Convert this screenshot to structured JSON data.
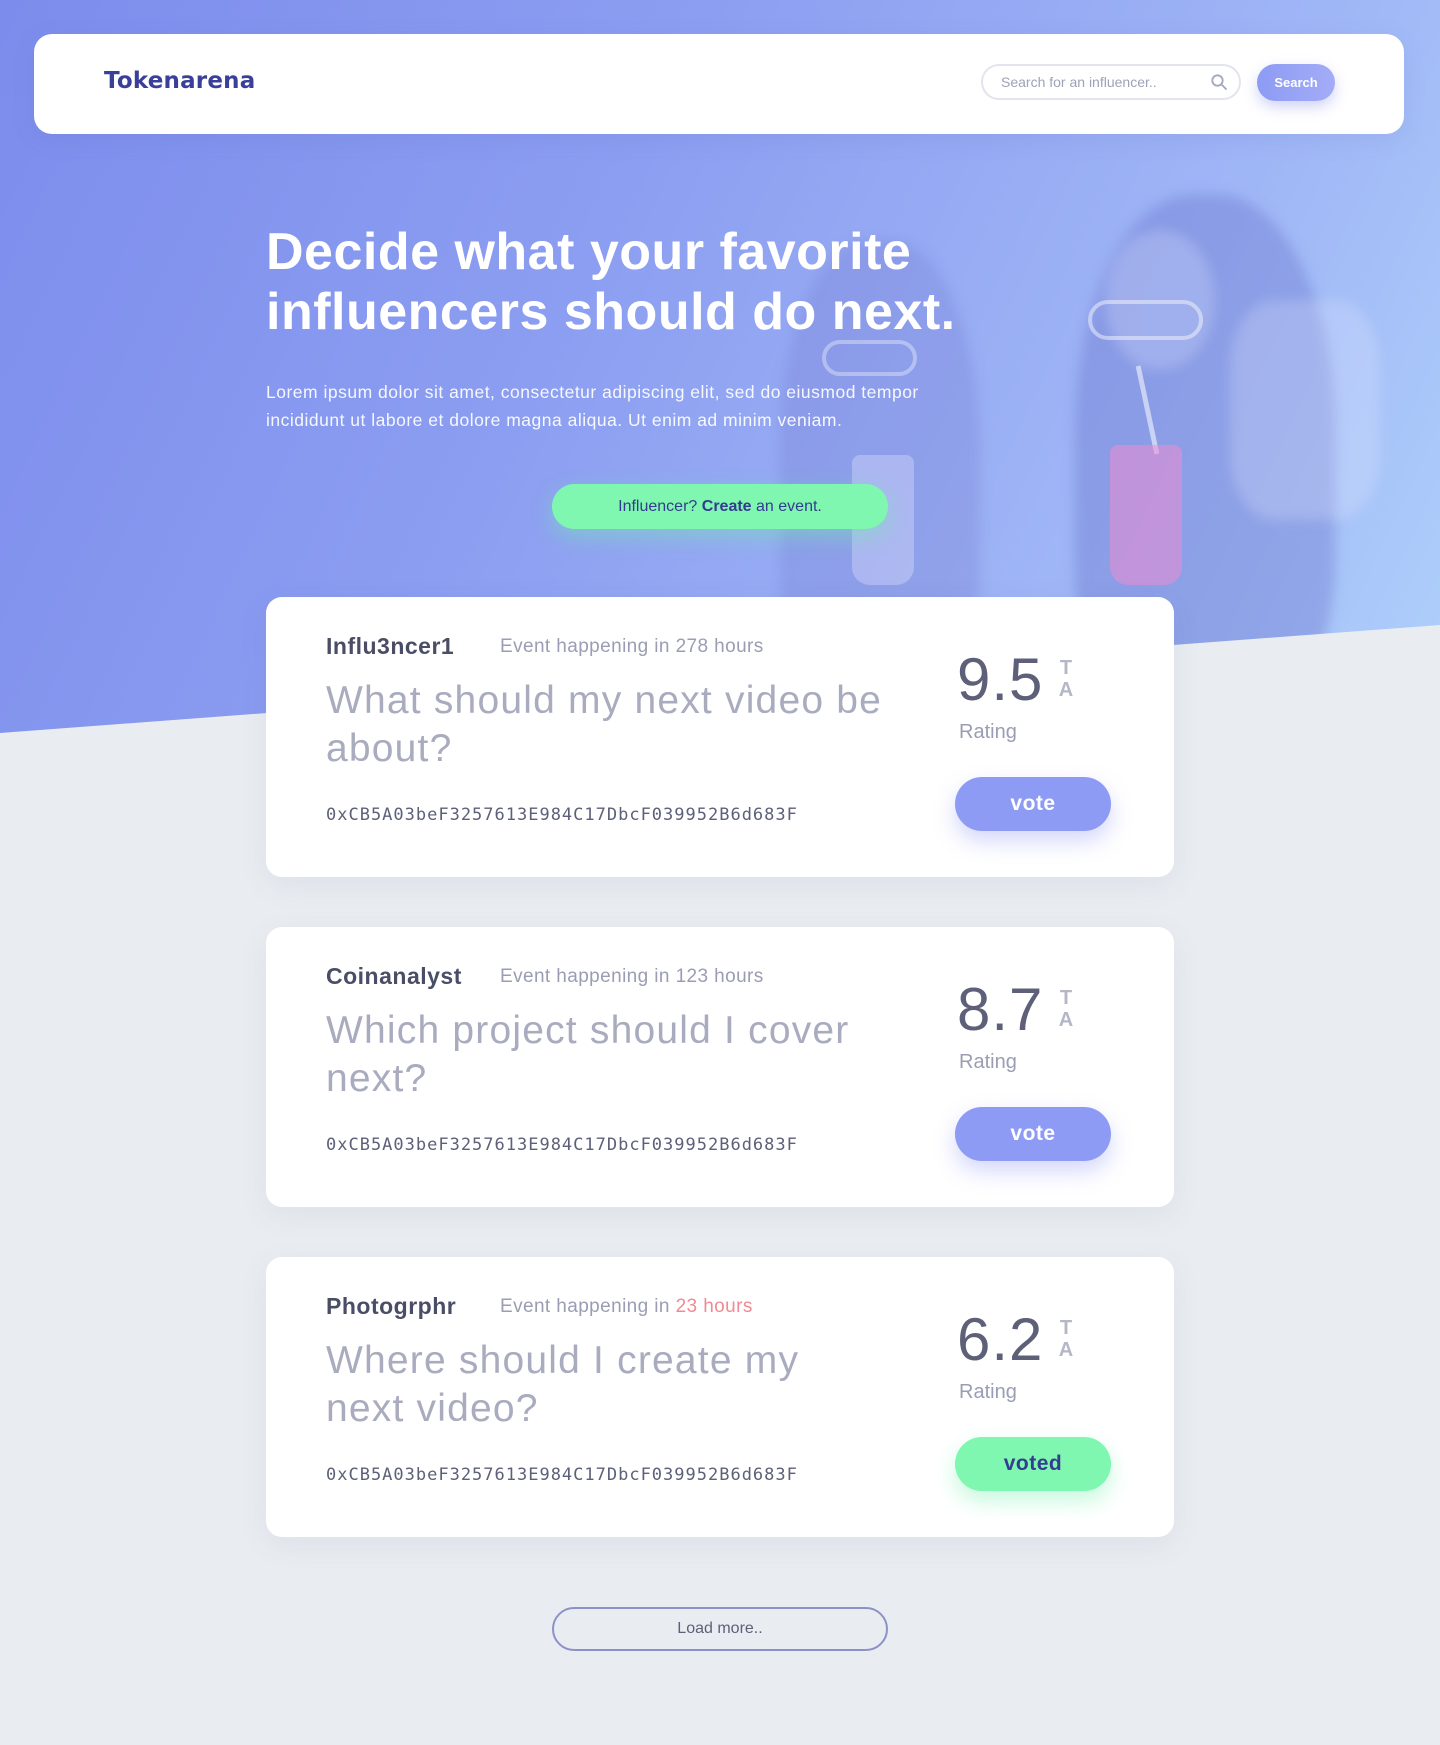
{
  "header": {
    "logo": "Tokenarena",
    "search_placeholder": "Search for an influencer..",
    "search_button": "Search",
    "search_icon": "magnifier-icon"
  },
  "hero": {
    "title": "Decide what your favorite influencers should do next.",
    "description": "Lorem ipsum dolor sit amet, consectetur adipiscing elit, sed do eiusmod tempor incididunt ut labore et dolore magna aliqua. Ut enim ad minim veniam.",
    "cta_prefix": "Influencer?",
    "cta_bold": "Create",
    "cta_suffix": "an event."
  },
  "events": [
    {
      "name": "Influ3ncer1",
      "time_prefix": "Event happening in",
      "time_value": "278 hours",
      "question": "What should my next video be about?",
      "address": "0xCB5A03beF3257613E984C17DbcF039952B6d683F",
      "rating": "9.5",
      "rating_unit_top": "T",
      "rating_unit_bottom": "A",
      "rating_label": "Rating",
      "button_label": "vote",
      "voted": false
    },
    {
      "name": "Coinanalyst",
      "time_prefix": "Event happening in",
      "time_value": "123 hours",
      "question": "Which project should I cover next?",
      "address": "0xCB5A03beF3257613E984C17DbcF039952B6d683F",
      "rating": "8.7",
      "rating_unit_top": "T",
      "rating_unit_bottom": "A",
      "rating_label": "Rating",
      "button_label": "vote",
      "voted": false
    },
    {
      "name": "Photogrphr",
      "time_prefix": "Event happening in",
      "time_value": "23 hours",
      "question": "Where should I create my next video?",
      "address": "0xCB5A03beF3257613E984C17DbcF039952B6d683F",
      "rating": "6.2",
      "rating_unit_top": "T",
      "rating_unit_bottom": "A",
      "rating_label": "Rating",
      "button_label": "voted",
      "voted": true
    }
  ],
  "load_more": "Load more..",
  "colors": {
    "brand": "#3a3f99",
    "accent_blue": "#8e9bf5",
    "accent_green": "#7ff7b0",
    "urgent": "#f08a94"
  }
}
